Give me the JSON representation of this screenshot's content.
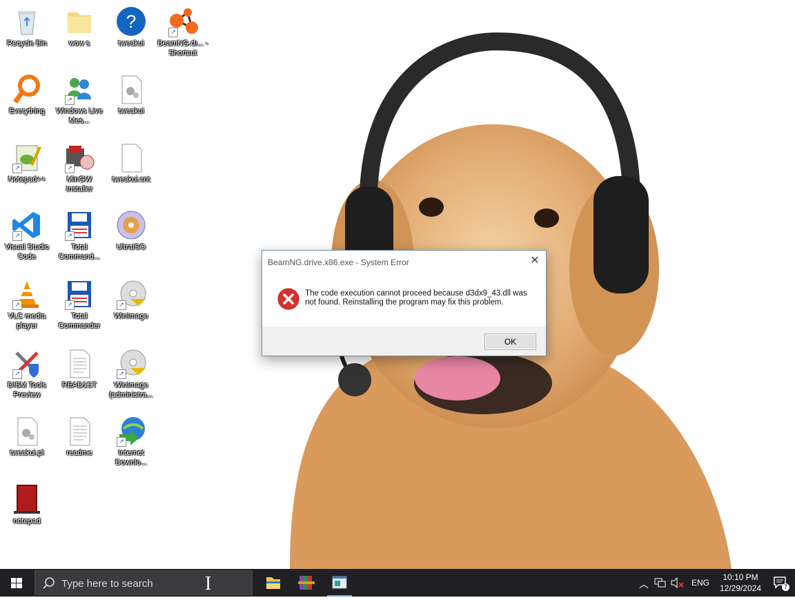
{
  "desktop": {
    "icons": [
      {
        "label": "Recycle Bin"
      },
      {
        "label": "wow s"
      },
      {
        "label": "tweakui"
      },
      {
        "label": "BeamNG.dr... - Shortcut"
      },
      {
        "label": "Everything"
      },
      {
        "label": "Windows Live Mes..."
      },
      {
        "label": "tweakui"
      },
      {
        "label": "Notepad++"
      },
      {
        "label": "MinGW Installer"
      },
      {
        "label": "tweakui.cnt"
      },
      {
        "label": "Visual Studio Code"
      },
      {
        "label": "Total Command..."
      },
      {
        "label": "UltraISO"
      },
      {
        "label": "VLC media player"
      },
      {
        "label": "Total Commander"
      },
      {
        "label": "WinImage"
      },
      {
        "label": "DISM Tools Preview"
      },
      {
        "label": "READ1ST"
      },
      {
        "label": "WinImage (administra..."
      },
      {
        "label": "tweakui.pl"
      },
      {
        "label": "readme"
      },
      {
        "label": "Internet Downlo..."
      },
      {
        "label": "notepad"
      }
    ]
  },
  "dialog": {
    "title": "BeamNG.drive.x86.exe - System Error",
    "message": "The code execution cannot proceed because d3dx9_43.dll was not found. Reinstalling the program may fix this problem.",
    "ok_label": "OK",
    "close_glyph": "✕"
  },
  "taskbar": {
    "search_placeholder": "Type here to search",
    "language": "ENG",
    "time": "10:10 PM",
    "date": "12/29/2024",
    "notification_count": "7"
  }
}
